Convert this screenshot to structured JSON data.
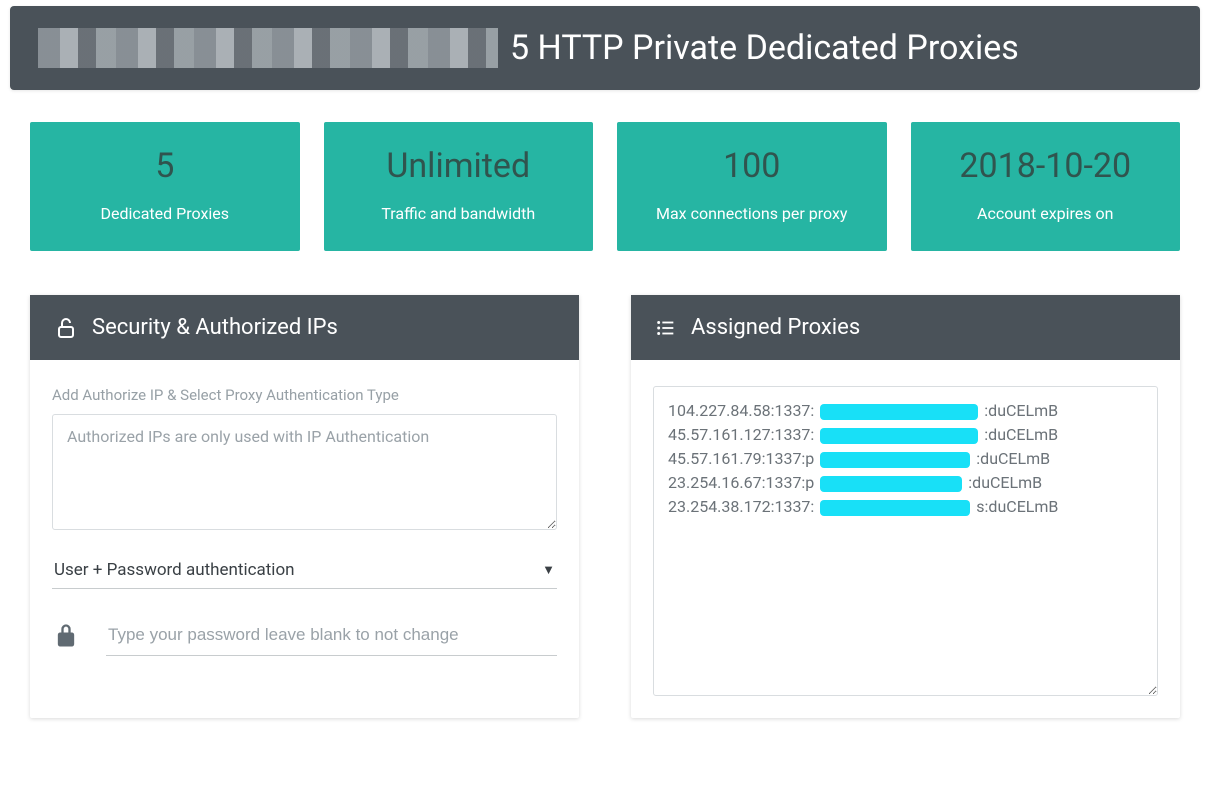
{
  "header": {
    "title": "5 HTTP Private Dedicated Proxies"
  },
  "stats": [
    {
      "value": "5",
      "label": "Dedicated Proxies"
    },
    {
      "value": "Unlimited",
      "label": "Traffic and bandwidth"
    },
    {
      "value": "100",
      "label": "Max connections per proxy"
    },
    {
      "value": "2018-10-20",
      "label": "Account expires on"
    }
  ],
  "security_panel": {
    "title": "Security & Authorized IPs",
    "field_label": "Add Authorize IP & Select Proxy Authentication Type",
    "textarea_placeholder": "Authorized IPs are only used with IP Authentication",
    "auth_select_value": "User + Password authentication",
    "password_placeholder": "Type your password leave blank to not change"
  },
  "proxies_panel": {
    "title": "Assigned Proxies",
    "lines": [
      {
        "prefix": "104.227.84.58:1337:",
        "redact_w": 158,
        "suffix": ":duCELmB"
      },
      {
        "prefix": "45.57.161.127:1337:",
        "redact_w": 158,
        "suffix": ":duCELmB"
      },
      {
        "prefix": "45.57.161.79:1337:p",
        "redact_w": 150,
        "suffix": ":duCELmB"
      },
      {
        "prefix": "23.254.16.67:1337:p",
        "redact_w": 142,
        "suffix": ":duCELmB"
      },
      {
        "prefix": "23.254.38.172:1337:",
        "redact_w": 150,
        "suffix": "s:duCELmB"
      }
    ]
  }
}
